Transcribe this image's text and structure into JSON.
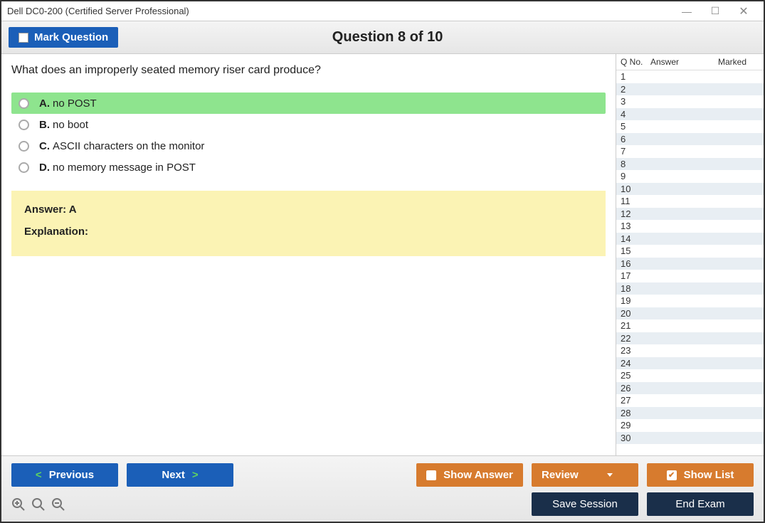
{
  "titlebar": {
    "title": "Dell DC0-200 (Certified Server Professional)"
  },
  "header": {
    "mark_label": "Mark Question",
    "question_num": "Question 8 of 10"
  },
  "question": {
    "text": "What does an improperly seated memory riser card produce?",
    "options": [
      {
        "letter": "A.",
        "text": "no POST",
        "selected": true
      },
      {
        "letter": "B.",
        "text": "no boot",
        "selected": false
      },
      {
        "letter": "C.",
        "text": "ASCII characters on the monitor",
        "selected": false
      },
      {
        "letter": "D.",
        "text": "no memory message in POST",
        "selected": false
      }
    ]
  },
  "answer": {
    "line": "Answer: A",
    "explanation_label": "Explanation:"
  },
  "sidebar": {
    "head": {
      "qno": "Q No.",
      "answer": "Answer",
      "marked": "Marked"
    },
    "rows": [
      "1",
      "2",
      "3",
      "4",
      "5",
      "6",
      "7",
      "8",
      "9",
      "10",
      "11",
      "12",
      "13",
      "14",
      "15",
      "16",
      "17",
      "18",
      "19",
      "20",
      "21",
      "22",
      "23",
      "24",
      "25",
      "26",
      "27",
      "28",
      "29",
      "30"
    ]
  },
  "footer": {
    "previous": "Previous",
    "next": "Next",
    "show_answer": "Show Answer",
    "review": "Review",
    "show_list": "Show List",
    "save_session": "Save Session",
    "end_exam": "End Exam"
  }
}
